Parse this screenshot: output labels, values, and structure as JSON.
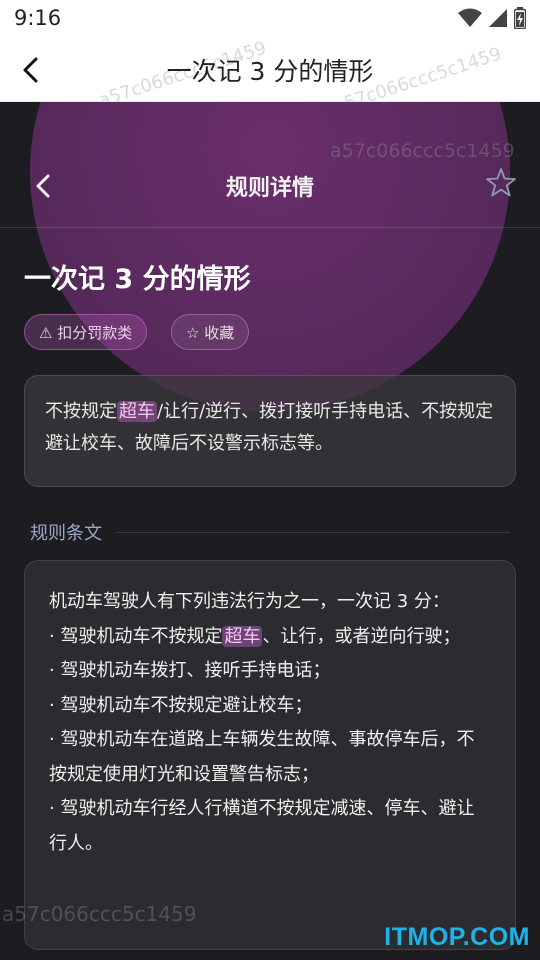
{
  "status": {
    "time": "9:16",
    "icons": [
      "wifi-icon",
      "signal-icon",
      "battery-icon"
    ]
  },
  "appbar": {
    "back_icon": "chevron-left-icon",
    "title": "一次记 3 分的情形"
  },
  "rule_header": {
    "back_icon": "chevron-left-icon",
    "title": "规则详情",
    "star_icon": "star-outline-icon"
  },
  "rule": {
    "title": "一次记 3 分的情形",
    "category_tag": "⚠ 扣分罚款类",
    "favorite_tag": "☆ 收藏",
    "summary": {
      "before": "不按规定",
      "highlight": "超车",
      "after": "/让行/逆行、拨打接听手持电话、不按规定避让校车、故障后不设警示标志等。"
    }
  },
  "article_section": {
    "label": "规则条文",
    "intro": "机动车驾驶人有下列违法行为之一，一次记 3 分：",
    "item1_before": "· 驾驶机动车不按规定",
    "item1_highlight": "超车",
    "item1_after": "、让行，或者逆向行驶；",
    "item2": "· 驾驶机动车拨打、接听手持电话；",
    "item3": "· 驾驶机动车不按规定避让校车；",
    "item4": "· 驾驶机动车在道路上车辆发生故障、事故停车后，不按规定使用灯光和设置警告标志；",
    "item5": "· 驾驶机动车行经人行横道不按规定减速、停车、避让行人。"
  },
  "watermarks": {
    "top_left": "a57c066ccc5c1459",
    "top_mid": "a57c066ccc5c1459",
    "top_right": "a57c066ccc5c1459",
    "bottom_left": "a57c066ccc5c1459"
  },
  "footer": {
    "logo": "ITMOP.COM"
  },
  "colors": {
    "accent": "#be64c8",
    "highlight_text": "#f3c6f5",
    "section_label": "#9aa6c6",
    "logo": "#1fb3ea"
  }
}
